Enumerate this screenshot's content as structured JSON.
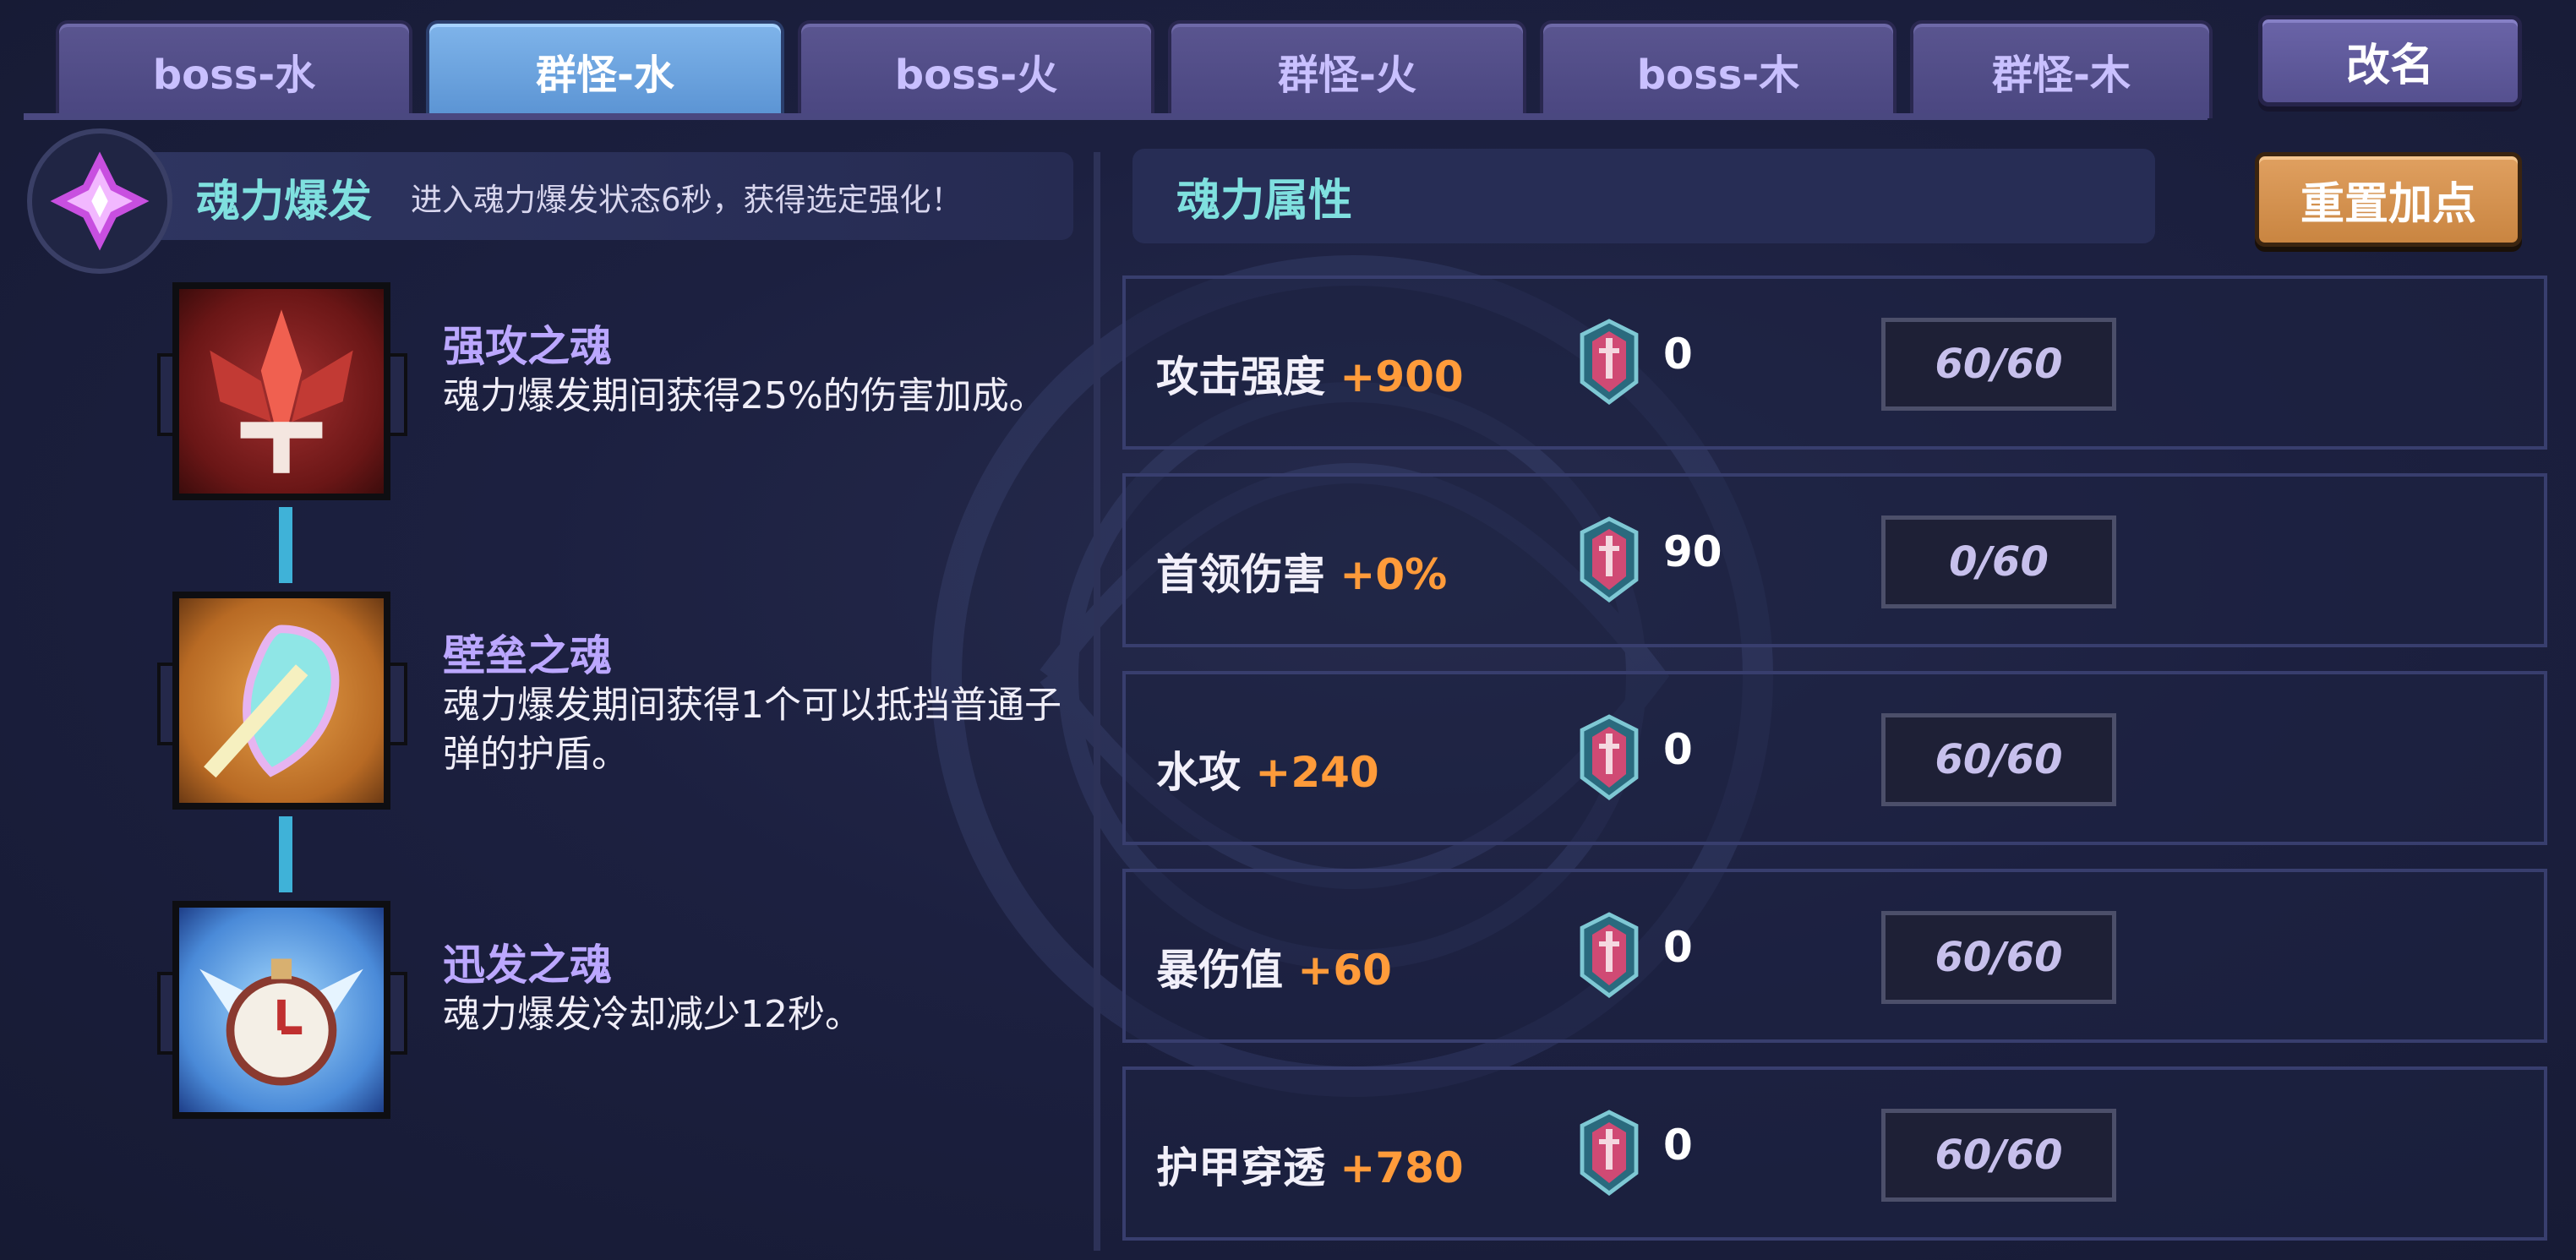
{
  "tabs": [
    {
      "label": "boss-水",
      "active": false
    },
    {
      "label": "群怪-水",
      "active": true
    },
    {
      "label": "boss-火",
      "active": false
    },
    {
      "label": "群怪-火",
      "active": false
    },
    {
      "label": "boss-木",
      "active": false
    },
    {
      "label": "群怪-木",
      "active": false
    }
  ],
  "rename_button": "改名",
  "reset_button": "重置加点",
  "burst": {
    "title": "魂力爆发",
    "description": "进入魂力爆发状态6秒，获得选定强化！"
  },
  "souls": [
    {
      "name": "强攻之魂",
      "description": "魂力爆发期间获得25%的伤害加成。",
      "icon": "sword-crest-icon"
    },
    {
      "name": "壁垒之魂",
      "description": "魂力爆发期间获得1个可以抵挡普通子弹的护盾。",
      "icon": "shield-icon"
    },
    {
      "name": "迅发之魂",
      "description": "魂力爆发冷却减少12秒。",
      "icon": "winged-clock-icon"
    }
  ],
  "attributes": {
    "title": "魂力属性",
    "rows": [
      {
        "name": "攻击强度",
        "bonus": "+900",
        "gems": "0",
        "level": "60/60"
      },
      {
        "name": "首领伤害",
        "bonus": "+0%",
        "gems": "90",
        "level": "0/60"
      },
      {
        "name": "水攻",
        "bonus": "+240",
        "gems": "0",
        "level": "60/60"
      },
      {
        "name": "暴伤值",
        "bonus": "+60",
        "gems": "0",
        "level": "60/60"
      },
      {
        "name": "护甲穿透",
        "bonus": "+780",
        "gems": "0",
        "level": "60/60"
      }
    ]
  },
  "colors": {
    "accent_cyan": "#7fe0df",
    "soul_name": "#bba7ff",
    "bonus_orange": "#ff9b3a",
    "tab_active": "#6aa4e0",
    "reset_orange": "#d79350"
  }
}
